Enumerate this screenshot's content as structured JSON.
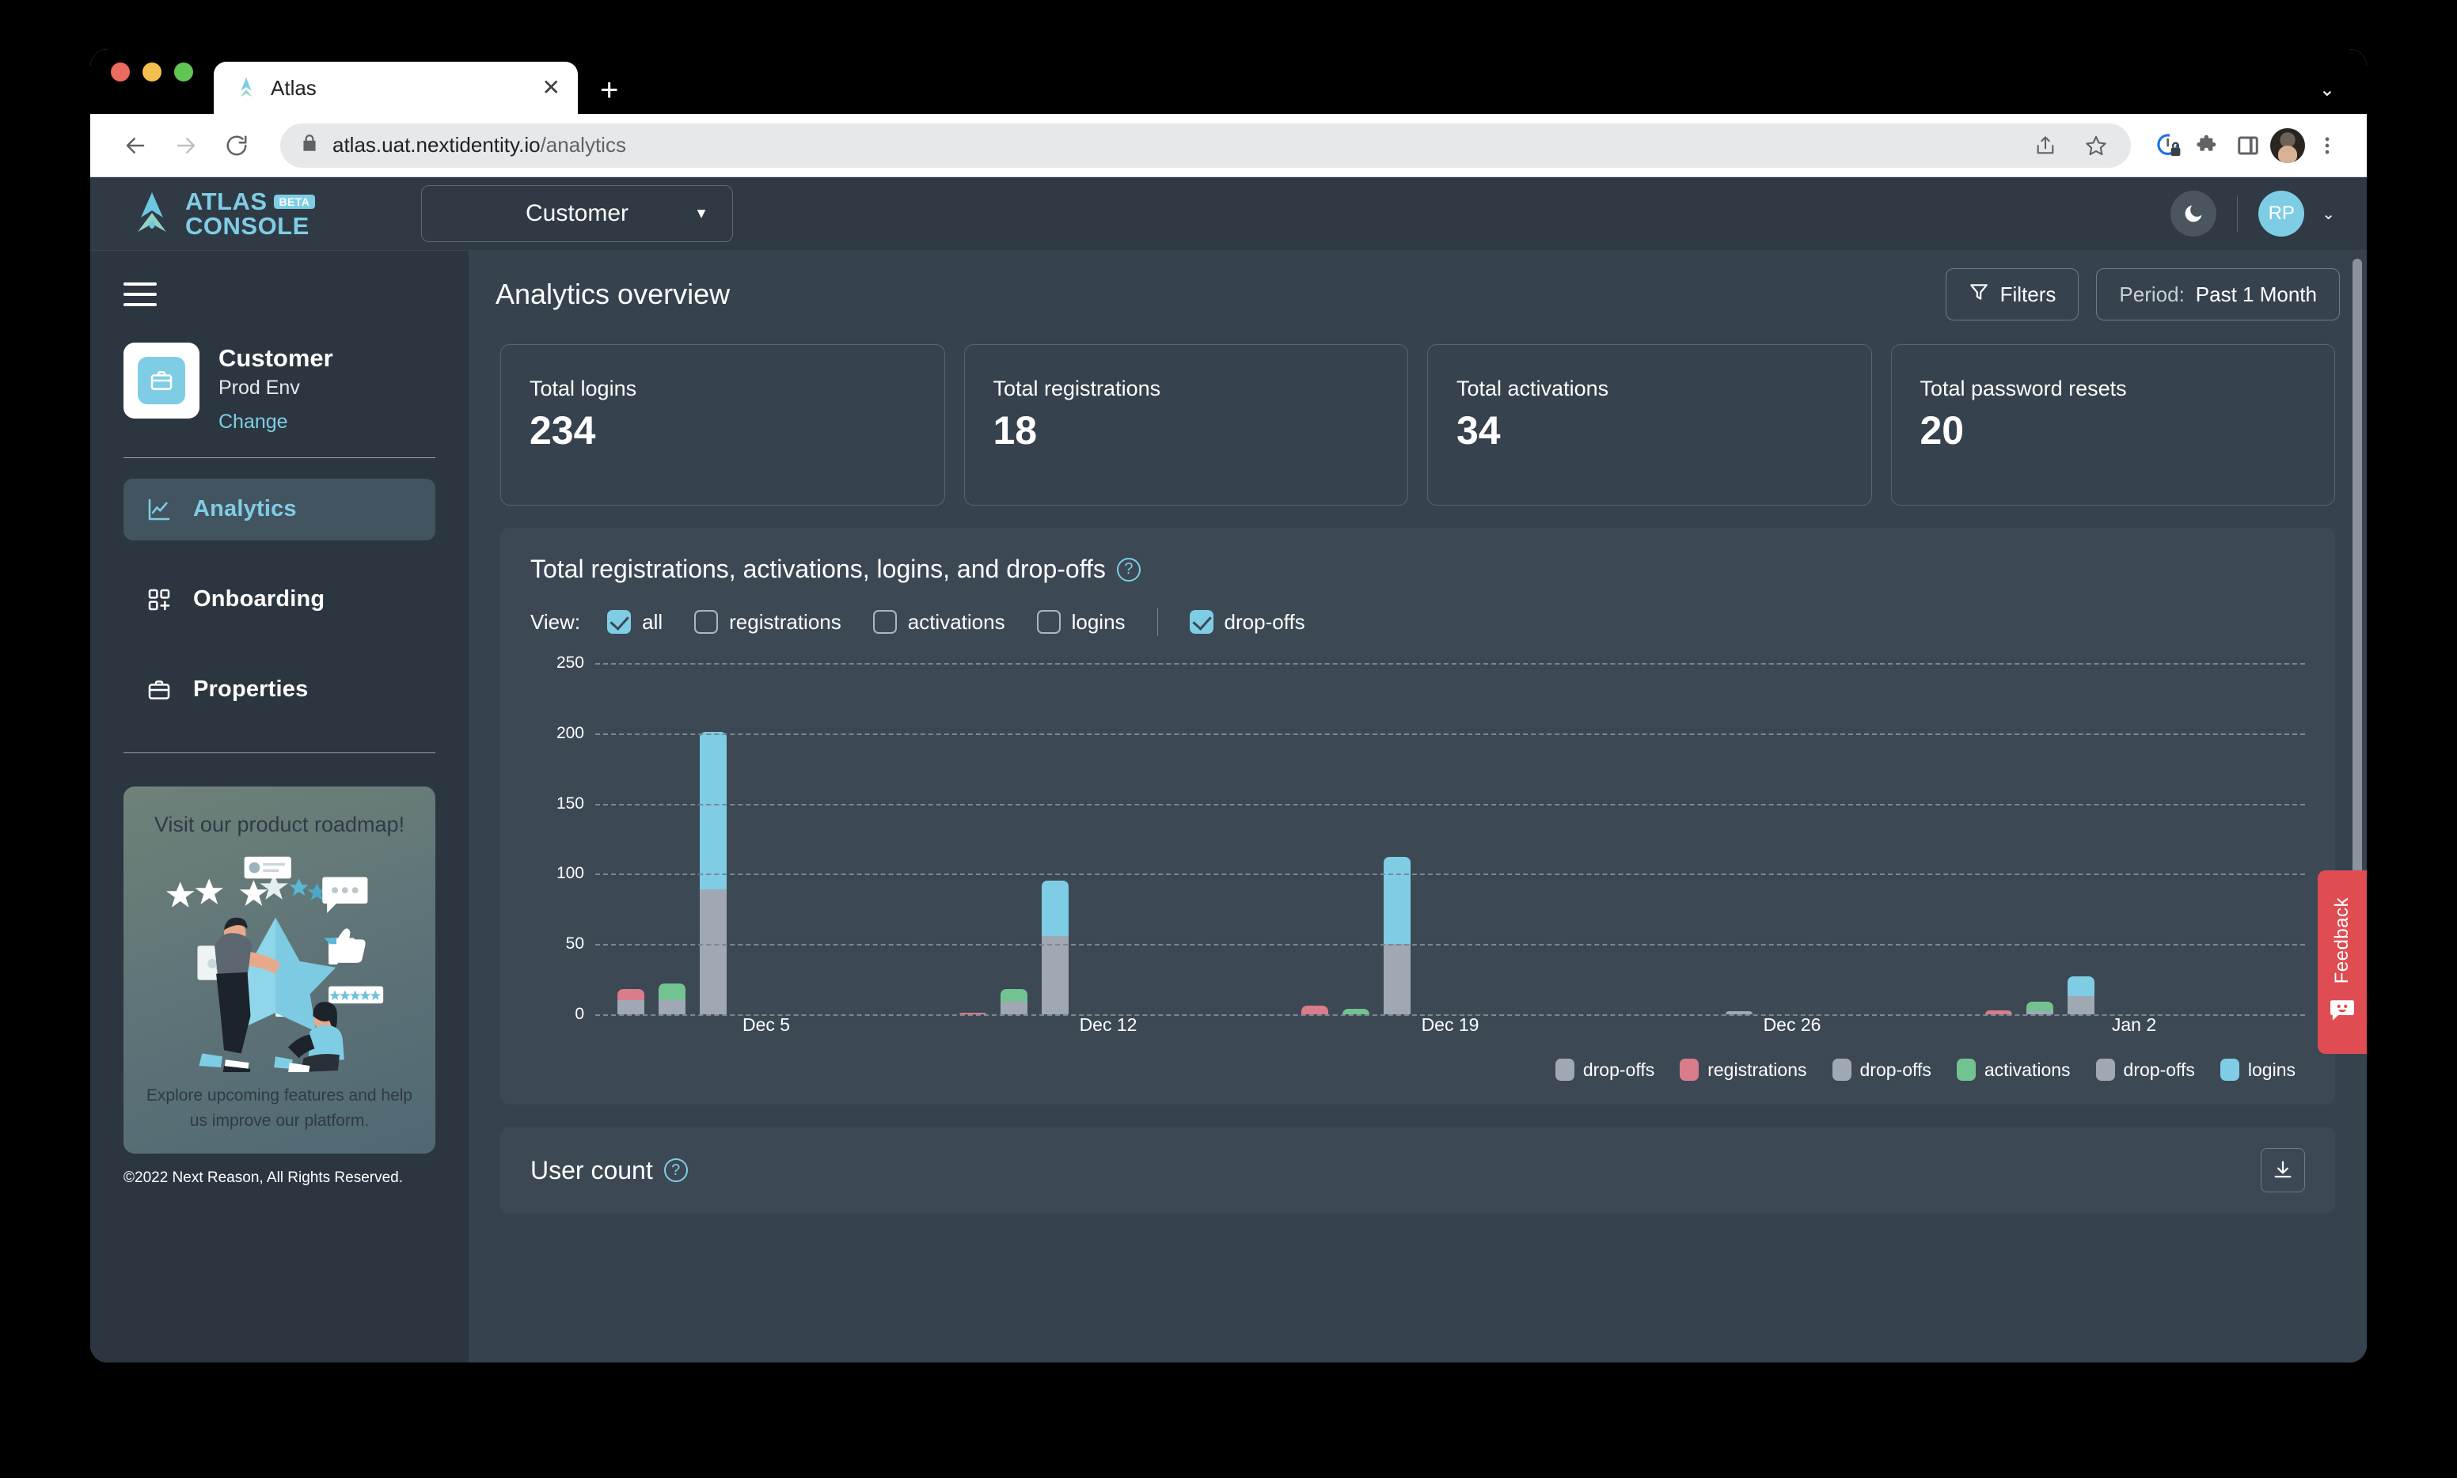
{
  "browser": {
    "tab_title": "Atlas",
    "tab_favicon_icon": "atlas-logo-icon",
    "close_icon": "close-icon",
    "new_tab_icon": "plus-icon",
    "tabstrip_caret_icon": "chevron-down-icon",
    "back_icon": "arrow-left-icon",
    "forward_icon": "arrow-right-icon",
    "reload_icon": "reload-icon",
    "lock_icon": "lock-icon",
    "url_host": "atlas.uat.nextidentity.io",
    "url_path": "/analytics",
    "share_icon": "share-icon",
    "bookmark_icon": "star-icon",
    "privacy_icon": "privacy-lock-icon",
    "extensions_icon": "puzzle-piece-icon",
    "sidepanel_icon": "side-panel-icon",
    "profile_icon": "profile-avatar-icon",
    "menu_icon": "three-dots-menu-icon"
  },
  "header": {
    "logo_line1": "ATLAS",
    "logo_line2": "CONSOLE",
    "beta_badge": "BETA",
    "org_selector_value": "Customer",
    "org_selector_caret_icon": "chevron-down-icon",
    "theme_toggle_icon": "moon-icon",
    "user_initials": "RP",
    "user_caret_icon": "chevron-down-icon"
  },
  "sidebar": {
    "hamburger_icon": "hamburger-menu-icon",
    "org": {
      "icon": "briefcase-icon",
      "name": "Customer",
      "environment": "Prod Env",
      "change_link": "Change"
    },
    "items": [
      {
        "label": "Analytics",
        "icon": "line-chart-icon",
        "active": true
      },
      {
        "label": "Onboarding",
        "icon": "add-module-icon",
        "active": false
      },
      {
        "label": "Properties",
        "icon": "briefcase-icon",
        "active": false
      }
    ],
    "promo": {
      "title": "Visit our product roadmap!",
      "subtitle": "Explore upcoming features and help us improve our platform.",
      "art_icon": "feedback-illustration"
    },
    "copyright": "©2022 Next Reason, All Rights Reserved."
  },
  "page": {
    "title": "Analytics overview",
    "filters_button": "Filters",
    "filters_icon": "filter-funnel-icon",
    "period_prefix": "Period:",
    "period_value": "Past 1 Month"
  },
  "stats": [
    {
      "label": "Total logins",
      "value": "234"
    },
    {
      "label": "Total registrations",
      "value": "18"
    },
    {
      "label": "Total activations",
      "value": "34"
    },
    {
      "label": "Total password resets",
      "value": "20"
    }
  ],
  "chart_card": {
    "title": "Total registrations, activations, logins, and drop-offs",
    "help_icon": "question-mark-icon",
    "view_label": "View:",
    "view_options": [
      {
        "label": "all",
        "checked": true
      },
      {
        "label": "registrations",
        "checked": false
      },
      {
        "label": "activations",
        "checked": false
      },
      {
        "label": "logins",
        "checked": false
      },
      {
        "label": "drop-offs",
        "checked": true
      }
    ]
  },
  "chart_data": {
    "type": "bar",
    "title": "Total registrations, activations, logins, and drop-offs",
    "xlabel": "",
    "ylabel": "",
    "ylim": [
      0,
      250
    ],
    "yticks": [
      0,
      50,
      100,
      150,
      200,
      250
    ],
    "grid": true,
    "stacked": true,
    "legend_position": "bottom-right",
    "categories": [
      "Dec 5",
      "Dec 12",
      "Dec 19",
      "Dec 26",
      "Jan 2"
    ],
    "series": [
      {
        "name": "registrations",
        "color": "#d97c8c",
        "values": [
          8,
          1,
          6,
          0,
          3
        ]
      },
      {
        "name": "registrations drop-offs",
        "color": "#a0a8b3",
        "values": [
          10,
          0,
          0,
          0,
          0
        ]
      },
      {
        "name": "activations",
        "color": "#72c391",
        "values": [
          12,
          9,
          4,
          0,
          7
        ]
      },
      {
        "name": "activations drop-offs",
        "color": "#a0a8b3",
        "values": [
          10,
          9,
          0,
          0,
          2
        ]
      },
      {
        "name": "logins",
        "color": "#7fcde5",
        "values": [
          112,
          39,
          62,
          0,
          14
        ]
      },
      {
        "name": "logins drop-offs",
        "color": "#a0a8b3",
        "values": [
          89,
          56,
          50,
          2,
          13
        ]
      }
    ],
    "legend": [
      {
        "label": "drop-offs",
        "color": "#a0a8b3"
      },
      {
        "label": "registrations",
        "color": "#d97c8c"
      },
      {
        "label": "drop-offs",
        "color": "#a0a8b3"
      },
      {
        "label": "activations",
        "color": "#72c391"
      },
      {
        "label": "drop-offs",
        "color": "#a0a8b3"
      },
      {
        "label": "logins",
        "color": "#7fcde5"
      }
    ]
  },
  "user_count_card": {
    "title": "User count",
    "help_icon": "question-mark-icon",
    "download_icon": "download-icon"
  },
  "feedback": {
    "label": "Feedback",
    "icon": "smiley-chat-icon"
  }
}
